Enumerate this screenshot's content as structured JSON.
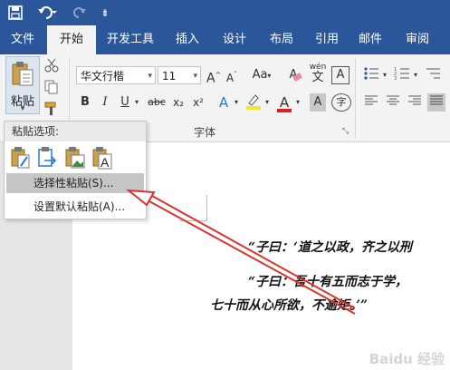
{
  "quick_access": {
    "more_label": "⇟"
  },
  "tabs": [
    {
      "label": "文件"
    },
    {
      "label": "开始"
    },
    {
      "label": "开发工具"
    },
    {
      "label": "插入"
    },
    {
      "label": "设计"
    },
    {
      "label": "布局"
    },
    {
      "label": "引用"
    },
    {
      "label": "邮件"
    },
    {
      "label": "审阅"
    }
  ],
  "ribbon": {
    "paste_label": "粘贴",
    "font_name": "华文行楷",
    "font_size": "11",
    "font_group_label": "字体",
    "grow_font": "A",
    "shrink_font": "A",
    "change_case": "Aa",
    "clear_format": "A",
    "phonetic_top": "wén",
    "phonetic_bottom": "文",
    "char_border": "A",
    "bold": "B",
    "italic": "I",
    "underline": "U",
    "strikethrough": "abc",
    "subscript": "x₂",
    "superscript": "x²",
    "text_effect": "A",
    "font_color": "A",
    "char_shading": "A",
    "enclose": "字"
  },
  "paste_menu": {
    "header": "粘贴选项:",
    "items": [
      {
        "label": "选择性粘贴(S)..."
      },
      {
        "label": "设置默认粘贴(A)..."
      }
    ]
  },
  "document": {
    "lines": [
      "“子曰：‘道之以政，齐之以刑",
      "“子曰：吾十有五而志于学，",
      "七十而从心所欲，不逾矩。’”"
    ]
  },
  "watermark": "Baidu 经验",
  "colors": {
    "title_bar": "#2b579a",
    "ribbon": "#f3f3f3",
    "arrow": "#d9342b",
    "highlight": "#f5e62a",
    "font_color_bar": "#e02020"
  }
}
